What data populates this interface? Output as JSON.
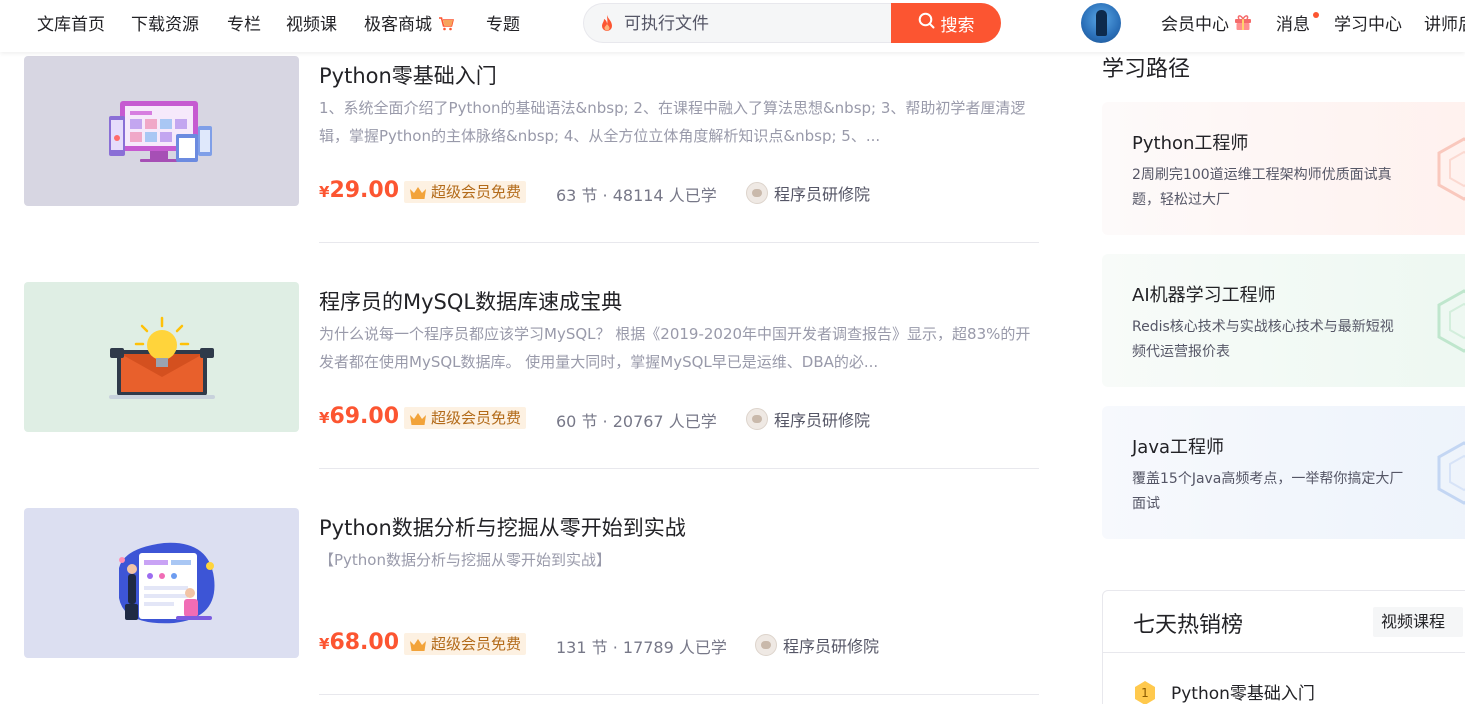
{
  "nav": {
    "items": [
      "文库首页",
      "下载资源",
      "专栏",
      "视频课",
      "极客商城",
      "专题"
    ],
    "search_placeholder": "可执行文件",
    "search_button": "搜索",
    "right_links": [
      "会员中心",
      "消息",
      "学习中心",
      "讲师后"
    ]
  },
  "courses": [
    {
      "title": "Python零基础入门",
      "description": "1、系统全面介绍了Python的基础语法&nbsp; 2、在课程中融入了算法思想&nbsp; 3、帮助初学者厘清逻辑，掌握Python的主体脉络&nbsp; 4、从全方位立体角度解析知识点&nbsp; 5、...",
      "price": "29.00",
      "currency": "¥",
      "vip_tag": "超级会员免费",
      "meta": "63 节 · 48114 人已学",
      "org": "程序员研修院"
    },
    {
      "title": "程序员的MySQL数据库速成宝典",
      "description": "为什么说每一个程序员都应该学习MySQL？ 根据《2019-2020年中国开发者调查报告》显示，超83%的开发者都在使用MySQL数据库。 使用量大同时，掌握MySQL早已是运维、DBA的必...",
      "price": "69.00",
      "currency": "¥",
      "vip_tag": "超级会员免费",
      "meta": "60 节 · 20767 人已学",
      "org": "程序员研修院"
    },
    {
      "title": "Python数据分析与挖掘从零开始到实战",
      "description": "【Python数据分析与挖掘从零开始到实战】",
      "price": "68.00",
      "currency": "¥",
      "vip_tag": "超级会员免费",
      "meta": "131 节 · 17789 人已学",
      "org": "程序员研修院"
    }
  ],
  "sidebar": {
    "learning_path_title": "学习路径",
    "paths": [
      {
        "title": "Python工程师",
        "description": "2周刷完100道运维工程架构师优质面试真题，轻松过大厂",
        "accent": "#fc5531"
      },
      {
        "title": "AI机器学习工程师",
        "description": "Redis核心技术与实战核心技术与最新短视频代运营报价表",
        "accent": "#3fbf7f"
      },
      {
        "title": "Java工程师",
        "description": "覆盖15个Java高频考点，一举帮你搞定大厂面试",
        "accent": "#5a8fe0"
      }
    ],
    "hot": {
      "title": "七天热销榜",
      "tab": "视频课程",
      "items": [
        {
          "rank": "1",
          "title": "Python零基础入门"
        }
      ]
    }
  }
}
